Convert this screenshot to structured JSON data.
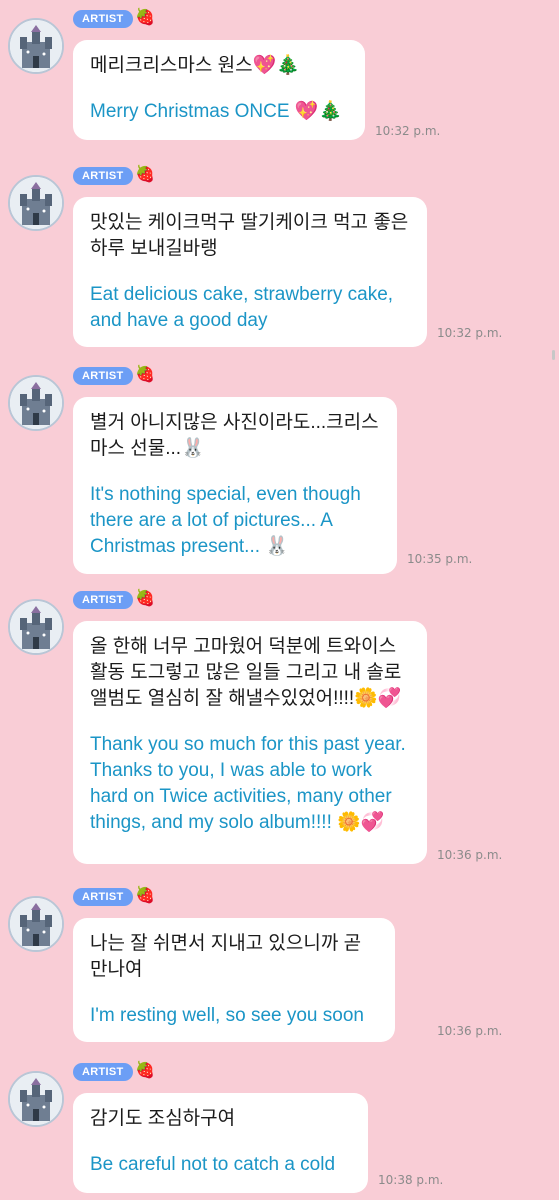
{
  "badge_label": "ARTIST",
  "badge_icon": "strawberry",
  "messages": [
    {
      "ko": "메리크리스마스 원스💖🎄",
      "en": "Merry Christmas ONCE 💖🎄",
      "time": "10:32 p.m."
    },
    {
      "ko": "맛있는 케이크먹구 딸기케이크 먹고 좋은하루 보내길바랭",
      "en": "Eat delicious cake, strawberry cake, and have a good day",
      "time": "10:32 p.m."
    },
    {
      "ko": "별거 아니지많은 사진이라도...크리스마스 선물...🐰",
      "en": "It's nothing special, even though there are a lot of pictures... A Christmas present... 🐰",
      "time": "10:35 p.m."
    },
    {
      "ko": "올 한해 너무 고마웠어 덕분에 트와이스 활동 도그렇고 많은 일들 그리고 내 솔로 앨범도 열심히 잘 해낼수있었어!!!!🌼💞",
      "en": "Thank you so much for this past year. Thanks to you, I was able to work hard on Twice activities, many other things, and my solo album!!!! 🌼💞",
      "time": "10:36 p.m."
    },
    {
      "ko": "나는 잘 쉬면서 지내고 있으니까 곧 만나여",
      "en": "I'm resting well, so see you soon",
      "time": "10:36 p.m."
    },
    {
      "ko": "감기도 조심하구여",
      "en": "Be careful not to catch a cold",
      "time": "10:38 p.m."
    }
  ],
  "colors": {
    "background": "#f9cdd6",
    "badge": "#6c9ef5",
    "korean_text": "#1b1b1b",
    "english_text": "#1b95c6",
    "timestamp": "#8b8b8b"
  }
}
